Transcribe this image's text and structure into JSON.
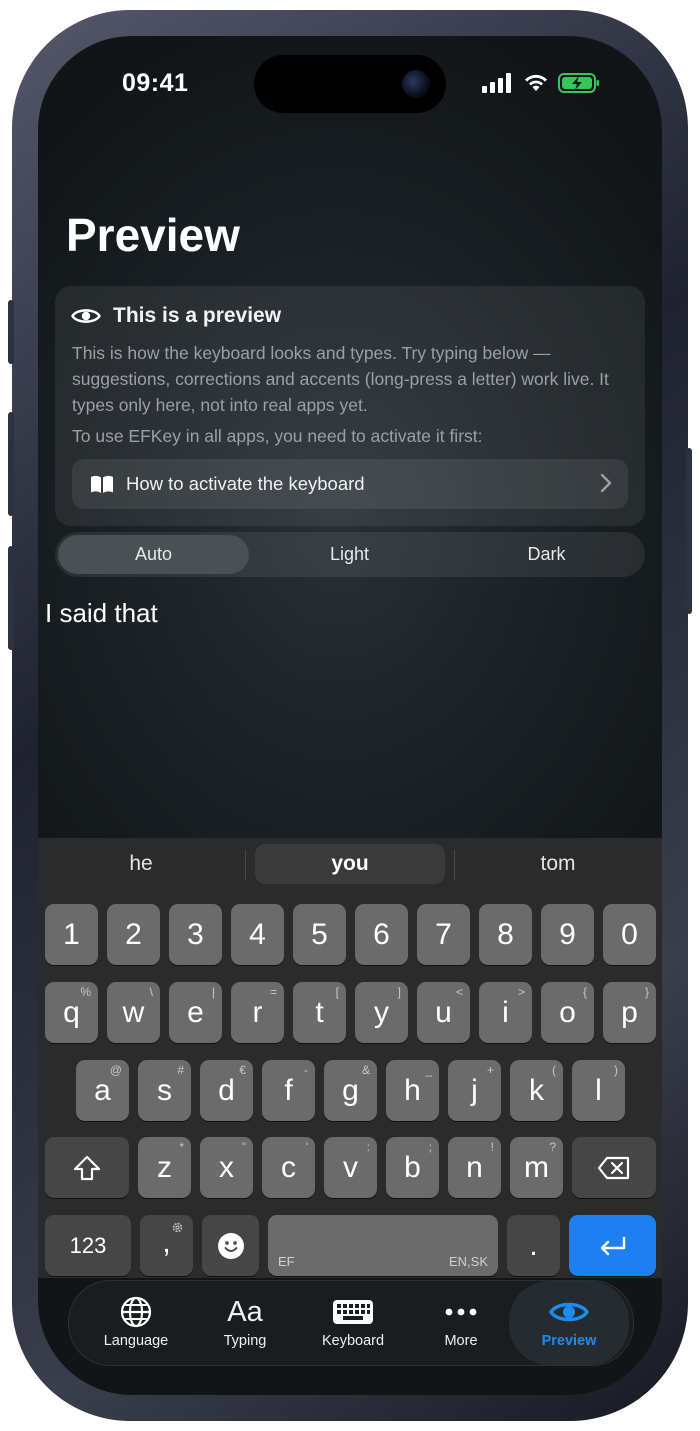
{
  "status": {
    "time": "09:41"
  },
  "page": {
    "title": "Preview"
  },
  "card": {
    "title": "This is a preview",
    "body": "This is how the keyboard looks and types. Try typing below — suggestions, corrections and accents (long-press a letter) work live. It types only here, not into real apps yet.",
    "note": "To use EFKey in all apps, you need to activate it first:",
    "activate_label": "How to activate the keyboard"
  },
  "theme": {
    "options": [
      "Auto",
      "Light",
      "Dark"
    ],
    "selected": "Auto"
  },
  "input": {
    "text": "I said that"
  },
  "suggestions": [
    "he",
    "you",
    "tom"
  ],
  "keyboard": {
    "numbers": [
      "1",
      "2",
      "3",
      "4",
      "5",
      "6",
      "7",
      "8",
      "9",
      "0"
    ],
    "row1": [
      {
        "k": "q",
        "a": "%"
      },
      {
        "k": "w",
        "a": "\\"
      },
      {
        "k": "e",
        "a": "|"
      },
      {
        "k": "r",
        "a": "="
      },
      {
        "k": "t",
        "a": "["
      },
      {
        "k": "y",
        "a": "]"
      },
      {
        "k": "u",
        "a": "<"
      },
      {
        "k": "i",
        "a": ">"
      },
      {
        "k": "o",
        "a": "{"
      },
      {
        "k": "p",
        "a": "}"
      }
    ],
    "row2": [
      {
        "k": "a",
        "a": "@"
      },
      {
        "k": "s",
        "a": "#"
      },
      {
        "k": "d",
        "a": "€"
      },
      {
        "k": "f",
        "a": "-"
      },
      {
        "k": "g",
        "a": "&"
      },
      {
        "k": "h",
        "a": "_"
      },
      {
        "k": "j",
        "a": "+"
      },
      {
        "k": "k",
        "a": "("
      },
      {
        "k": "l",
        "a": ")"
      }
    ],
    "row3": [
      {
        "k": "z",
        "a": "*"
      },
      {
        "k": "x",
        "a": "\""
      },
      {
        "k": "c",
        "a": "'"
      },
      {
        "k": "v",
        "a": ":"
      },
      {
        "k": "b",
        "a": ";"
      },
      {
        "k": "n",
        "a": "!"
      },
      {
        "k": "m",
        "a": "?"
      }
    ],
    "numbers_key": "123",
    "comma": ",",
    "period": ".",
    "space_left": "EF",
    "space_right": "EN,SK"
  },
  "tabs": [
    {
      "label": "Language",
      "icon": "globe-icon"
    },
    {
      "label": "Typing",
      "icon": "text-size-icon",
      "glyph": "Aa"
    },
    {
      "label": "Keyboard",
      "icon": "keyboard-icon"
    },
    {
      "label": "More",
      "icon": "ellipsis-icon"
    },
    {
      "label": "Preview",
      "icon": "eye-icon",
      "active": true
    }
  ],
  "colors": {
    "accent": "#1d8cf0",
    "enter_key": "#1d7ff0"
  }
}
